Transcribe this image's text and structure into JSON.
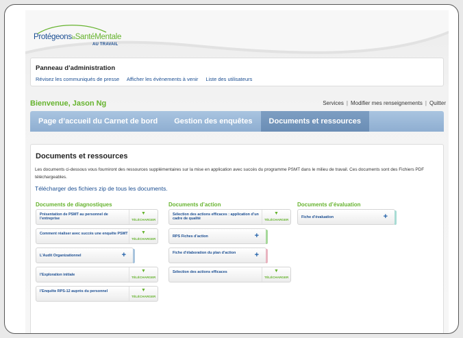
{
  "logo": {
    "part1": "Protégeons",
    "part2": "la",
    "part3": "SantéMentale",
    "sub": "AU TRAVAIL"
  },
  "admin": {
    "title": "Panneau d’administration",
    "links": [
      "Révisez les communiqués de presse",
      "Afficher les évènements à venir",
      "Liste des utilisateurs"
    ]
  },
  "welcome": "Bienvenue, Jason Ng",
  "user_links": [
    "Services",
    "Modifier mes renseignements",
    "Quitter"
  ],
  "nav": {
    "tabs": [
      "Page d’accueil du Carnet de bord",
      "Gestion des enquêtes",
      "Documents et ressources"
    ],
    "active": "Documents et ressources"
  },
  "content": {
    "title": "Documents et ressources",
    "description": "Les documents ci-dessous vous fourniront des ressources supplémentaires sur la mise en application avec succès du programme PSMT dans le milieu de travail. Ces documents sont des Fichiers PDF téléchargeables.",
    "zip_link": "Télécharger des fichiers zip de tous les documents."
  },
  "download_label": "TÉLÉCHARGER",
  "columns": [
    {
      "title": "Documents de diagnostiques",
      "items": [
        {
          "label": "Présentation de PSMT au personnel de l’entreprise",
          "kind": "download"
        },
        {
          "label": "Comment réaliser avec succès une enquête PSMT",
          "kind": "download"
        },
        {
          "label": "L’Audit Organizationnel",
          "kind": "plus",
          "edge": "#a8c4dd"
        },
        {
          "label": "l’Exploration initiale",
          "kind": "download"
        },
        {
          "label": "l’Enquête RPS-12 auprès du personnel",
          "kind": "download"
        }
      ]
    },
    {
      "title": "Documents d’action",
      "items": [
        {
          "label": "Sélection des actions efficaces : application d’un cadre de qualité",
          "kind": "download"
        },
        {
          "label": "RPS Fiches d’action",
          "kind": "plus",
          "edge": "#a6d89a"
        },
        {
          "label": "Fiche d’élaboration du plan d’action",
          "kind": "plus",
          "edge": "#e8b4c0"
        },
        {
          "label": "Sélection des actions efficaces",
          "kind": "download"
        }
      ]
    },
    {
      "title": "Documents d’évaluation",
      "items": [
        {
          "label": "Fiche d’évaluation",
          "kind": "plus",
          "edge": "#a8dcd4"
        }
      ]
    }
  ]
}
